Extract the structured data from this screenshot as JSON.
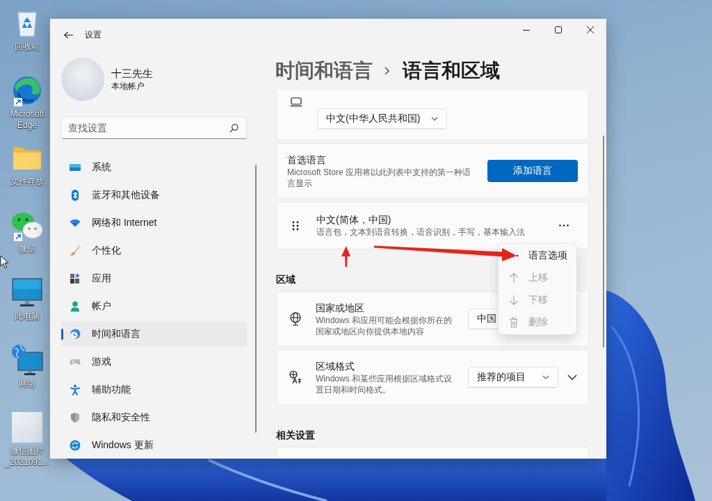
{
  "desktop": {
    "icons": [
      {
        "label": "回收站",
        "kind": "recycle_bin",
        "shortcut": false
      },
      {
        "label": "Microsoft Edge",
        "kind": "browser",
        "shortcut": true
      },
      {
        "label": "文件存放",
        "kind": "folder",
        "shortcut": false
      },
      {
        "label": "微信",
        "kind": "chat",
        "shortcut": true
      },
      {
        "label": "此电脑",
        "kind": "computer",
        "shortcut": false
      },
      {
        "label": "网络",
        "kind": "network",
        "shortcut": false
      },
      {
        "label": "微信图片_2021091...",
        "kind": "photo",
        "shortcut": false
      }
    ]
  },
  "window": {
    "title": "设置"
  },
  "account": {
    "name": "十三先生",
    "type": "本地帐户"
  },
  "search": {
    "placeholder": "查找设置"
  },
  "nav": [
    {
      "label": "系统",
      "kind": "system",
      "selected": false
    },
    {
      "label": "蓝牙和其他设备",
      "kind": "bluetooth",
      "selected": false
    },
    {
      "label": "网络和 Internet",
      "kind": "network",
      "selected": false
    },
    {
      "label": "个性化",
      "kind": "personalization",
      "selected": false
    },
    {
      "label": "应用",
      "kind": "apps",
      "selected": false
    },
    {
      "label": "帐户",
      "kind": "accounts",
      "selected": false
    },
    {
      "label": "时间和语言",
      "kind": "time_language",
      "selected": true
    },
    {
      "label": "游戏",
      "kind": "gaming",
      "selected": false
    },
    {
      "label": "辅助功能",
      "kind": "accessibility",
      "selected": false
    },
    {
      "label": "隐私和安全性",
      "kind": "privacy",
      "selected": false
    },
    {
      "label": "Windows 更新",
      "kind": "update",
      "selected": false
    }
  ],
  "breadcrumb": {
    "parent": "时间和语言",
    "current": "语言和区域"
  },
  "display_language": {
    "value": "中文(中华人民共和国)"
  },
  "preferred_languages": {
    "title": "首选语言",
    "description": "Microsoft Store 应用将以此列表中支持的第一种语言显示",
    "button": "添加语言"
  },
  "languages": [
    {
      "name": "中文(简体，中国)",
      "features": "语言包，文本到语音转换，语音识别，手写，基本输入法"
    }
  ],
  "context_menu": {
    "items": [
      {
        "label": "语言选项",
        "kind": "options",
        "disabled": false
      },
      {
        "label": "上移",
        "kind": "move_up",
        "disabled": true
      },
      {
        "label": "下移",
        "kind": "move_down",
        "disabled": true
      },
      {
        "label": "删除",
        "kind": "remove",
        "disabled": true
      }
    ]
  },
  "region": {
    "heading": "区域",
    "settings": [
      {
        "title": "国家或地区",
        "description": "Windows 和应用可能会根据你所在的国家或地区向你提供本地内容",
        "value": "中国",
        "kind": "country"
      },
      {
        "title": "区域格式",
        "description": "Windows 和某些应用根据区域格式设置日期和时间格式。",
        "value": "推荐的项目",
        "kind": "format"
      }
    ]
  },
  "related": {
    "heading": "相关设置"
  }
}
